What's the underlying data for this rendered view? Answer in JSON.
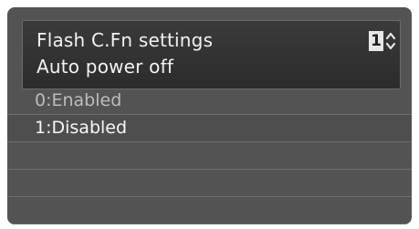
{
  "header": {
    "title": "Flash C.Fn settings",
    "subtitle": "Auto power off",
    "page_number": "1",
    "page_arrows_icon": "up-down-arrows-icon"
  },
  "options": [
    {
      "label": "0:Enabled",
      "state": "dim"
    },
    {
      "label": "1:Disabled",
      "state": "selected"
    }
  ],
  "empty_rows": 3,
  "colors": {
    "background": "#535353",
    "header_bg": "#2f2f2f",
    "text": "#f2f2f2",
    "dim_text": "#bcbcbc"
  }
}
